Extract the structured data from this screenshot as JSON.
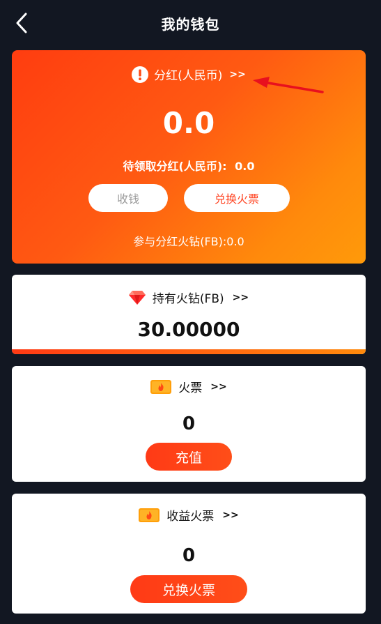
{
  "header": {
    "title": "我的钱包",
    "back_icon": "chevron-left-icon"
  },
  "dividend": {
    "label": "分红(人民币)",
    "arrows": ">>",
    "amount": "0.0",
    "pending_label": "待领取分红(人民币):",
    "pending_value": "0.0",
    "collect_label": "收钱",
    "exchange_label": "兑换火票",
    "fb_label": "参与分红火钻(FB):0.0",
    "icon": "alert-circle-icon",
    "annotation": "red-arrow"
  },
  "fb_card": {
    "label": "持有火钻(FB)",
    "arrows": ">>",
    "value": "30.00000",
    "icon": "diamond-icon"
  },
  "ticket_card": {
    "label": "火票",
    "arrows": ">>",
    "value": "0",
    "button_label": "充值",
    "icon": "fire-ticket-icon"
  },
  "income_card": {
    "label": "收益火票",
    "arrows": ">>",
    "value": "0",
    "button_label": "兑换火票",
    "icon": "fire-ticket-icon"
  },
  "colors": {
    "background": "#121722",
    "accent": "#ff4422",
    "gradient_start": "#ff3d10",
    "gradient_end": "#ff9a0a"
  }
}
